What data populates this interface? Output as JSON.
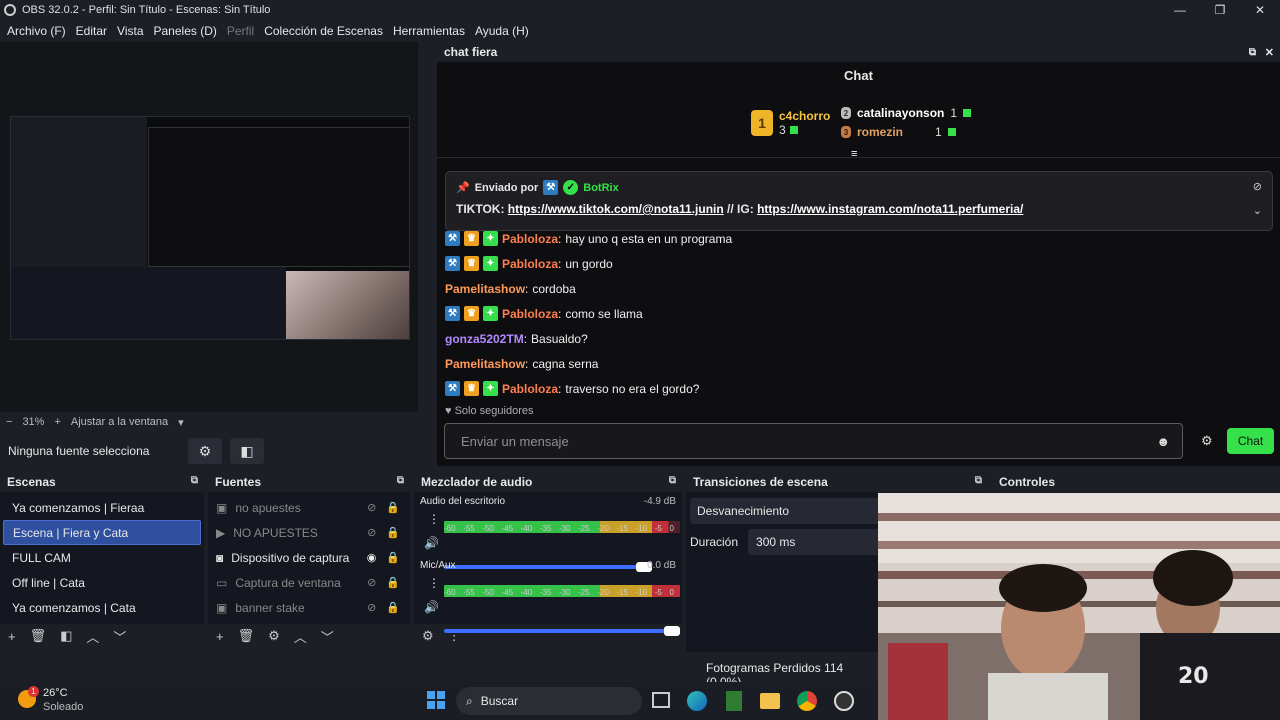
{
  "window": {
    "title": "OBS 32.0.2 - Perfil: Sin Título - Escenas: Sin Título"
  },
  "menu": [
    {
      "label": "Archivo (F)"
    },
    {
      "label": "Editar"
    },
    {
      "label": "Vista"
    },
    {
      "label": "Paneles (D)"
    },
    {
      "label": "Perfil",
      "disabled": true
    },
    {
      "label": "Colección de Escenas"
    },
    {
      "label": "Herramientas"
    },
    {
      "label": "Ayuda (H)"
    }
  ],
  "preview": {
    "zoom": "31%",
    "fit_label": "Ajustar a la ventana",
    "no_source": "Ninguna fuente selecciona"
  },
  "chat": {
    "dock_title": "chat fiera",
    "title": "Chat",
    "leaders": [
      {
        "rank": "1",
        "name": "c4chorro",
        "count": "3"
      },
      {
        "rank": "2",
        "name": "catalinayonson",
        "count": "1"
      },
      {
        "rank": "3",
        "name": "romezin",
        "count": "1"
      }
    ],
    "pinned": {
      "label": "Enviado por",
      "author": "BotRix",
      "text_prefix": "TIKTOK: ",
      "link1": "https://www.tiktok.com/@nota11.junin",
      "mid": " // IG: ",
      "link2": "https://www.instagram.com/nota11.perfumeria/"
    },
    "messages": [
      {
        "user": "Pabloloza",
        "text": "hay uno q esta en un programa",
        "badges": true,
        "cls": "u1"
      },
      {
        "user": "Pabloloza",
        "text": "un gordo",
        "badges": true,
        "cls": "u1"
      },
      {
        "user": "Pamelitashow",
        "text": "cordoba",
        "badges": false,
        "cls": "u2"
      },
      {
        "user": "Pabloloza",
        "text": "como se llama",
        "badges": true,
        "cls": "u1"
      },
      {
        "user": "gonza5202TM",
        "text": "Basualdo?",
        "badges": false,
        "cls": "u3"
      },
      {
        "user": "Pamelitashow",
        "text": "cagna serna",
        "badges": false,
        "cls": "u2"
      },
      {
        "user": "Pabloloza",
        "text": "traverso no era el gordo?",
        "badges": true,
        "cls": "u1"
      }
    ],
    "followers_only": "Solo seguidores",
    "input_placeholder": "Enviar un mensaje",
    "send_label": "Chat"
  },
  "scenes": {
    "title": "Escenas",
    "items": [
      {
        "label": "Ya comenzamos | Fieraa"
      },
      {
        "label": "Escena | Fiera y Cata",
        "selected": true
      },
      {
        "label": "FULL CAM"
      },
      {
        "label": "Off line | Cata"
      },
      {
        "label": "Ya comenzamos | Cata"
      }
    ]
  },
  "sources": {
    "title": "Fuentes",
    "items": [
      {
        "label": "no apuestes",
        "icon": "image-icon",
        "visible": false
      },
      {
        "label": "NO APUESTES",
        "icon": "media-icon",
        "visible": false
      },
      {
        "label": "Dispositivo de captura",
        "icon": "camera-icon",
        "visible": true
      },
      {
        "label": "Captura de ventana",
        "icon": "window-icon",
        "visible": false
      },
      {
        "label": "banner stake",
        "icon": "image-icon",
        "visible": false
      }
    ]
  },
  "mixer": {
    "title": "Mezclador de audio",
    "scale": [
      "-60",
      "-55",
      "-50",
      "-45",
      "-40",
      "-35",
      "-30",
      "-25",
      "-20",
      "-15",
      "-10",
      "-5",
      "0"
    ],
    "channels": [
      {
        "name": "Audio del escritorio",
        "db": "-4.9 dB",
        "level": 0.95
      },
      {
        "name": "Mic/Aux",
        "db": "0.0 dB",
        "level": 1.0
      }
    ]
  },
  "transitions": {
    "title": "Transiciones de escena",
    "type": "Desvanecimiento",
    "duration_label": "Duración",
    "duration": "300 ms"
  },
  "controls": {
    "title": "Controles"
  },
  "status": {
    "dropped": "Fotogramas Perdidos 114 (0.0%)"
  },
  "taskbar": {
    "temp": "26°C",
    "weather": "Soleado",
    "search": "Buscar",
    "badge": "1"
  },
  "colors": {
    "accent": "#2f4f9f",
    "chat_green": "#36e04a",
    "meter_green": "#35c14a",
    "meter_yellow": "#c8a02a",
    "meter_red": "#c0303a"
  }
}
